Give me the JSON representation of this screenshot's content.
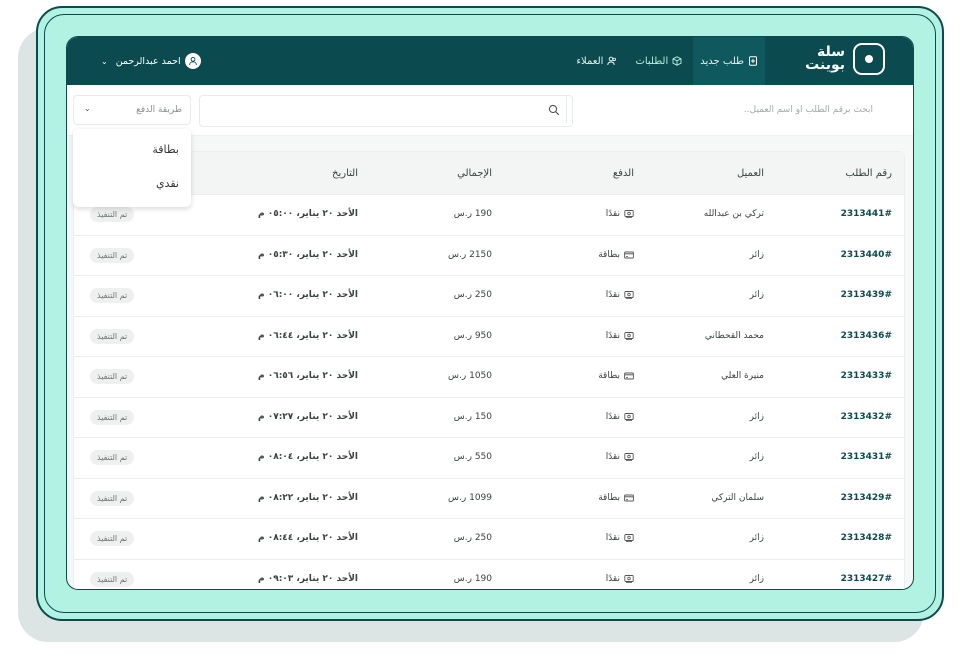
{
  "brand": {
    "name_line1": "سلة",
    "name_line2": "بوينت"
  },
  "nav": {
    "new_order": "طلب جديد",
    "orders": "الطلبات",
    "customers": "العملاء"
  },
  "user": {
    "name": "احمد عبدالرحمن"
  },
  "toolbar": {
    "search_placeholder": "ابحث برقم الطلب او اسم العميل..",
    "payment_filter": "طريقة الدفع"
  },
  "dropdown": {
    "options": [
      "بطاقة",
      "نقدي"
    ]
  },
  "table": {
    "headers": {
      "id": "رقم الطلب",
      "customer": "العميل",
      "payment": "الدفع",
      "total": "الإجمالي",
      "date": "التاريخ"
    },
    "rows": [
      {
        "id": "2313441#",
        "customer": "تركي بن عبدالله",
        "payment": "نقدًا",
        "pay_type": "cash",
        "total": "190 ر.س",
        "date": "الأحد ٢٠ يناير، ٠٥:٠٠ م",
        "status": "تم التنفيذ"
      },
      {
        "id": "2313440#",
        "customer": "زائر",
        "payment": "بطاقة",
        "pay_type": "card",
        "total": "2150 ر.س",
        "date": "الأحد ٢٠ يناير، ٠٥:٣٠ م",
        "status": "تم التنفيذ"
      },
      {
        "id": "2313439#",
        "customer": "زائر",
        "payment": "نقدًا",
        "pay_type": "cash",
        "total": "250 ر.س",
        "date": "الأحد ٢٠ يناير، ٠٦:٠٠ م",
        "status": "تم التنفيذ"
      },
      {
        "id": "2313436#",
        "customer": "محمد القحطاني",
        "payment": "نقدًا",
        "pay_type": "cash",
        "total": "950 ر.س",
        "date": "الأحد ٢٠ يناير، ٠٦:٤٤ م",
        "status": "تم التنفيذ"
      },
      {
        "id": "2313433#",
        "customer": "منيرة العلي",
        "payment": "بطاقة",
        "pay_type": "card",
        "total": "1050 ر.س",
        "date": "الأحد ٢٠ يناير، ٠٦:٥٦ م",
        "status": "تم التنفيذ"
      },
      {
        "id": "2313432#",
        "customer": "زائر",
        "payment": "نقدًا",
        "pay_type": "cash",
        "total": "150 ر.س",
        "date": "الأحد ٢٠ يناير، ٠٧:٢٧ م",
        "status": "تم التنفيذ"
      },
      {
        "id": "2313431#",
        "customer": "زائر",
        "payment": "نقدًا",
        "pay_type": "cash",
        "total": "550 ر.س",
        "date": "الأحد ٢٠ يناير، ٠٨:٠٤ م",
        "status": "تم التنفيذ"
      },
      {
        "id": "2313429#",
        "customer": "سلمان التركي",
        "payment": "بطاقة",
        "pay_type": "card",
        "total": "1099 ر.س",
        "date": "الأحد ٢٠ يناير، ٠٨:٢٢ م",
        "status": "تم التنفيذ"
      },
      {
        "id": "2313428#",
        "customer": "زائر",
        "payment": "نقدًا",
        "pay_type": "cash",
        "total": "250 ر.س",
        "date": "الأحد ٢٠ يناير، ٠٨:٤٤ م",
        "status": "تم التنفيذ"
      },
      {
        "id": "2313427#",
        "customer": "زائر",
        "payment": "نقدًا",
        "pay_type": "cash",
        "total": "190 ر.س",
        "date": "الأحد ٢٠ يناير، ٠٩:٠٣ م",
        "status": "تم التنفيذ"
      }
    ]
  },
  "colors": {
    "primary": "#0b4a4e",
    "frame": "#b1f2e2",
    "accent": "#b7f0e1"
  }
}
